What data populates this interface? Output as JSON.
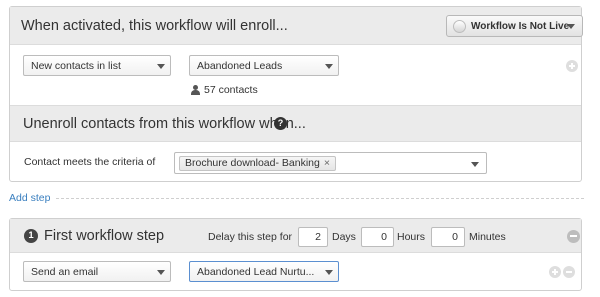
{
  "enroll": {
    "title": "When activated, this workflow will enroll...",
    "live_button": "Workflow Is Not Live",
    "list_type_select": "New contacts in list",
    "list_select": "Abandoned Leads",
    "contact_count": "57 contacts"
  },
  "unenroll": {
    "title": "Unenroll contacts from this workflow when...",
    "help_icon": "?",
    "criteria_label": "Contact meets the criteria of",
    "criteria_tag": "Brochure download- Banking",
    "tag_remove": "×"
  },
  "add_step": {
    "label": "Add step"
  },
  "step": {
    "number": "1",
    "title": "First workflow step",
    "delay_label": "Delay this step for",
    "days_value": "2",
    "days_label": "Days",
    "hours_value": "0",
    "hours_label": "Hours",
    "minutes_value": "0",
    "minutes_label": "Minutes",
    "action_select": "Send an email",
    "email_select": "Abandoned Lead Nurtu..."
  },
  "icons": {
    "live_toggle": "toggle-knob-icon",
    "caret": "chevron-down-icon",
    "person": "person-icon",
    "help": "help-icon",
    "add": "plus-circle-icon",
    "remove": "minus-circle-icon"
  },
  "colors": {
    "header_bg": "#ebebeb",
    "link": "#3a7fbf",
    "focus_border": "#5b8fd0"
  }
}
